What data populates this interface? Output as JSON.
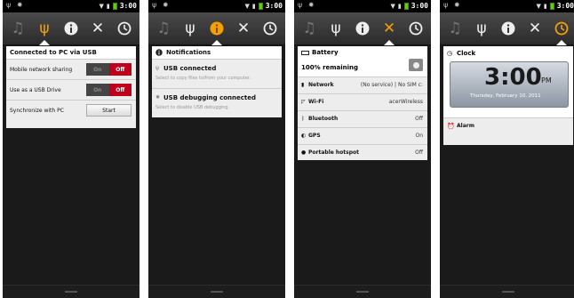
{
  "status": {
    "time": "3:00"
  },
  "screen1": {
    "title": "Connected to PC via USB",
    "rows": [
      {
        "label": "Mobile network sharing",
        "on": "On",
        "off": "Off"
      },
      {
        "label": "Use as a USB Drive",
        "on": "On",
        "off": "Off"
      },
      {
        "label": "Synchronize with PC",
        "button": "Start"
      }
    ]
  },
  "screen2": {
    "title": "Notifications",
    "items": [
      {
        "title": "USB connected",
        "sub": "Select to copy files to/from your computer."
      },
      {
        "title": "USB debugging connected",
        "sub": "Select to disable USB debugging."
      }
    ]
  },
  "screen3": {
    "battery_title": "Battery",
    "battery_value": "100% remaining",
    "rows": [
      {
        "label": "Network",
        "value": "(No service) | No SIM c:"
      },
      {
        "label": "Wi-Fi",
        "value": "acerWireless"
      },
      {
        "label": "Bluetooth",
        "value": "Off"
      },
      {
        "label": "GPS",
        "value": "On"
      },
      {
        "label": "Portable hotspot",
        "value": "Off"
      }
    ]
  },
  "screen4": {
    "clock_title": "Clock",
    "time": "3:00",
    "ampm": "PM",
    "date": "Thursday, February 10, 2011",
    "alarm_label": "Alarm"
  },
  "colors": {
    "accent": "#f4a100",
    "toggle_off": "#c0001a"
  }
}
